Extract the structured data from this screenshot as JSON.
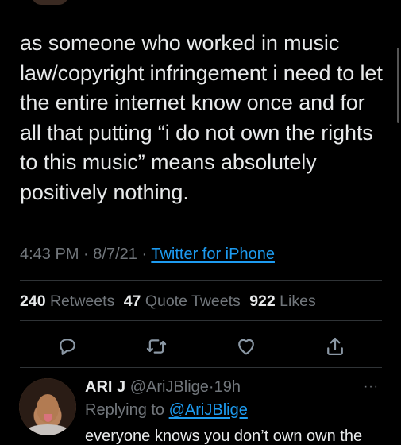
{
  "tweet": {
    "text": "as someone who worked in music law/copyright infringement i need to let the entire internet know once and for all that putting “i do not own the rights to this music” means absolutely positively nothing.",
    "time": "4:43 PM",
    "date": "8/7/21",
    "source": "Twitter for iPhone",
    "separator": "·"
  },
  "stats": {
    "retweets_count": "240",
    "retweets_label": "Retweets",
    "quotes_count": "47",
    "quotes_label": "Quote Tweets",
    "likes_count": "922",
    "likes_label": "Likes"
  },
  "actions": {
    "reply_icon": "reply-icon",
    "retweet_icon": "retweet-icon",
    "like_icon": "heart-icon",
    "share_icon": "share-icon"
  },
  "reply": {
    "name": "ARI J",
    "handle": "@AriJBlige",
    "separator": "·",
    "time": "19h",
    "more": "···",
    "replying_prefix": "Replying to",
    "replying_to": "@AriJBlige",
    "text": "everyone knows you don’t own own the"
  },
  "colors": {
    "background": "#000000",
    "text": "#e7e9ea",
    "muted": "#71767b",
    "link": "#1d9bf0",
    "divider": "#2f3336"
  }
}
